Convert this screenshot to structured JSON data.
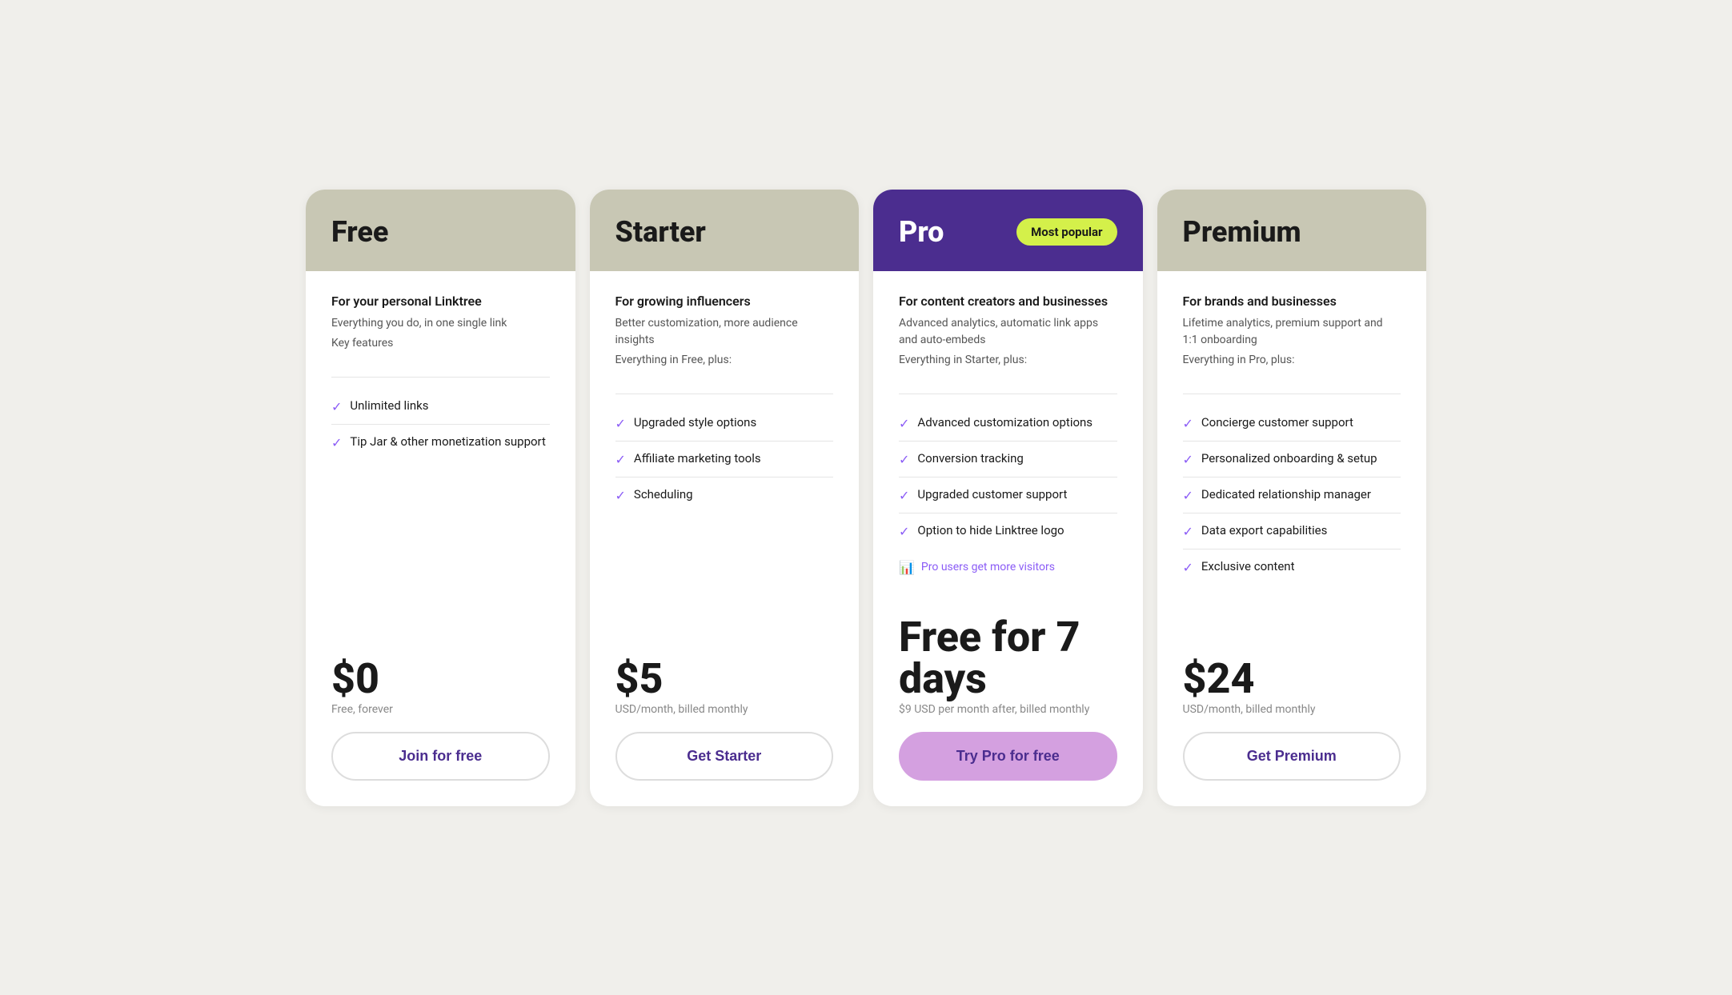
{
  "plans": [
    {
      "id": "free",
      "name": "Free",
      "header_style": "neutral",
      "name_color": "dark",
      "tagline": "For your personal Linktree",
      "description": "Everything you do, in one single link",
      "includes_label": "Key features",
      "features": [
        "Unlimited links",
        "Tip Jar & other monetization support"
      ],
      "promo": null,
      "price": "$0",
      "price_sub": "Free, forever",
      "cta_label": "Join for free",
      "cta_style": "outline"
    },
    {
      "id": "starter",
      "name": "Starter",
      "header_style": "neutral",
      "name_color": "dark",
      "tagline": "For growing influencers",
      "description": "Better customization, more audience insights",
      "includes_label": "Everything in Free, plus:",
      "features": [
        "Upgraded style options",
        "Affiliate marketing tools",
        "Scheduling"
      ],
      "promo": null,
      "price": "$5",
      "price_sub": "USD/month, billed monthly",
      "cta_label": "Get Starter",
      "cta_style": "outline"
    },
    {
      "id": "pro",
      "name": "Pro",
      "header_style": "purple",
      "name_color": "white",
      "badge": "Most popular",
      "tagline": "For content creators and businesses",
      "description": "Advanced analytics, automatic link apps and auto-embeds",
      "includes_label": "Everything in Starter, plus:",
      "features": [
        "Advanced customization options",
        "Conversion tracking",
        "Upgraded customer support",
        "Option to hide Linktree logo"
      ],
      "promo": "Pro users get more visitors",
      "price": "Free for 7 days",
      "price_sub": "$9 USD per month after, billed monthly",
      "cta_label": "Try Pro for free",
      "cta_style": "pro"
    },
    {
      "id": "premium",
      "name": "Premium",
      "header_style": "neutral",
      "name_color": "dark",
      "tagline": "For brands and businesses",
      "description": "Lifetime analytics, premium support and 1:1 onboarding",
      "includes_label": "Everything in Pro, plus:",
      "features": [
        "Concierge customer support",
        "Personalized onboarding & setup",
        "Dedicated relationship manager",
        "Data export capabilities",
        "Exclusive content"
      ],
      "promo": null,
      "price": "$24",
      "price_sub": "USD/month, billed monthly",
      "cta_label": "Get Premium",
      "cta_style": "outline"
    }
  ]
}
